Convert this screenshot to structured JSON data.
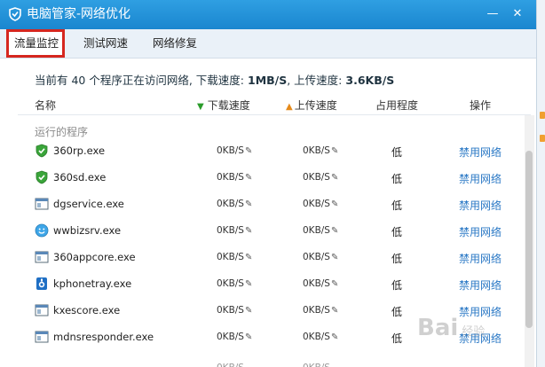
{
  "window": {
    "title": "电脑管家-网络优化",
    "minimize_glyph": "—",
    "close_glyph": "✕"
  },
  "tabs": [
    {
      "label": "流量监控",
      "active": true
    },
    {
      "label": "测试网速",
      "active": false
    },
    {
      "label": "网络修复",
      "active": false
    }
  ],
  "summary": {
    "prefix": "当前有 40 个程序正在访问网络, 下载速度: ",
    "download": "1MB/S",
    "middle": ", 上传速度: ",
    "upload": "3.6KB/S"
  },
  "columns": {
    "name": "名称",
    "download": "下载速度",
    "upload": "上传速度",
    "usage": "占用程度",
    "action": "操作"
  },
  "group_label": "运行的程序",
  "processes": [
    {
      "name": "360rp.exe",
      "icon": "green-shield-icon",
      "download": "0KB/S",
      "upload": "0KB/S",
      "usage": "低",
      "action": "禁用网络"
    },
    {
      "name": "360sd.exe",
      "icon": "green-shield-icon",
      "download": "0KB/S",
      "upload": "0KB/S",
      "usage": "低",
      "action": "禁用网络"
    },
    {
      "name": "dgservice.exe",
      "icon": "window-icon",
      "download": "0KB/S",
      "upload": "0KB/S",
      "usage": "低",
      "action": "禁用网络"
    },
    {
      "name": "wwbizsrv.exe",
      "icon": "smiley-icon",
      "download": "0KB/S",
      "upload": "0KB/S",
      "usage": "低",
      "action": "禁用网络"
    },
    {
      "name": "360appcore.exe",
      "icon": "window-icon",
      "download": "0KB/S",
      "upload": "0KB/S",
      "usage": "低",
      "action": "禁用网络"
    },
    {
      "name": "kphonetray.exe",
      "icon": "blue-phone-icon",
      "download": "0KB/S",
      "upload": "0KB/S",
      "usage": "低",
      "action": "禁用网络"
    },
    {
      "name": "kxescore.exe",
      "icon": "window-icon",
      "download": "0KB/S",
      "upload": "0KB/S",
      "usage": "低",
      "action": "禁用网络"
    },
    {
      "name": "mdnsresponder.exe",
      "icon": "window-icon",
      "download": "0KB/S",
      "upload": "0KB/S",
      "usage": "低",
      "action": "禁用网络"
    }
  ],
  "watermark": {
    "brand": "Bai",
    "suffix": "经验"
  },
  "colors": {
    "title_bar": "#1a86cf",
    "active_tab_outline": "#d6271f",
    "link": "#2a78c5"
  }
}
